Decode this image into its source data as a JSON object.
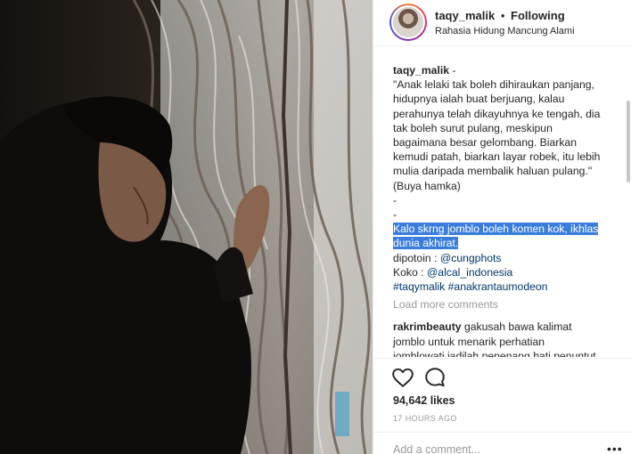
{
  "post": {
    "username": "taqy_malik",
    "separator": "•",
    "follow_status": "Following",
    "location": "Rahasia Hidung Mancung Alami"
  },
  "caption": {
    "username": "taqy_malik",
    "username_suffix": " -",
    "lines": [
      "\"Anak lelaki tak boleh dihiraukan panjang,",
      "hidupnya ialah buat berjuang, kalau",
      "perahunya telah dikayuhnya ke tengah, dia",
      "tak boleh surut pulang, meskipun",
      "bagaimana besar gelombang. Biarkan",
      "kemudi patah, biarkan layar robek, itu lebih",
      "mulia daripada membalik haluan pulang.\"",
      "(Buya hamka)",
      "-",
      "-"
    ],
    "highlighted_lines": [
      "Kalo skrng jomblo boleh komen kok, ikhlas",
      "dunia akhirat."
    ],
    "credit_1_label": "dipotoin : ",
    "credit_1_link": "@cungphots",
    "credit_2_label": "Koko : ",
    "credit_2_link": "@alcal_indonesia",
    "hashtags": "#taqymalik #anakrantaumodeon"
  },
  "load_more": "Load more comments",
  "comment": {
    "username": "rakrimbeauty",
    "lines": [
      "gakusah bawa kalimat",
      "jomblo untuk menarik perhatian",
      "jomblowati jadilah penenang hati penuntut"
    ]
  },
  "actions": {
    "like_icon": "heart-icon",
    "comment_icon": "comment-bubble-icon"
  },
  "likes": "94,642 likes",
  "time_ago": "17 HOURS AGO",
  "add_comment": {
    "placeholder": "Add a comment...",
    "more_icon": "ellipsis-icon",
    "more_symbol": "•••"
  },
  "colors": {
    "highlight": "#3b7ddd",
    "link": "#003569",
    "muted": "#999999"
  }
}
